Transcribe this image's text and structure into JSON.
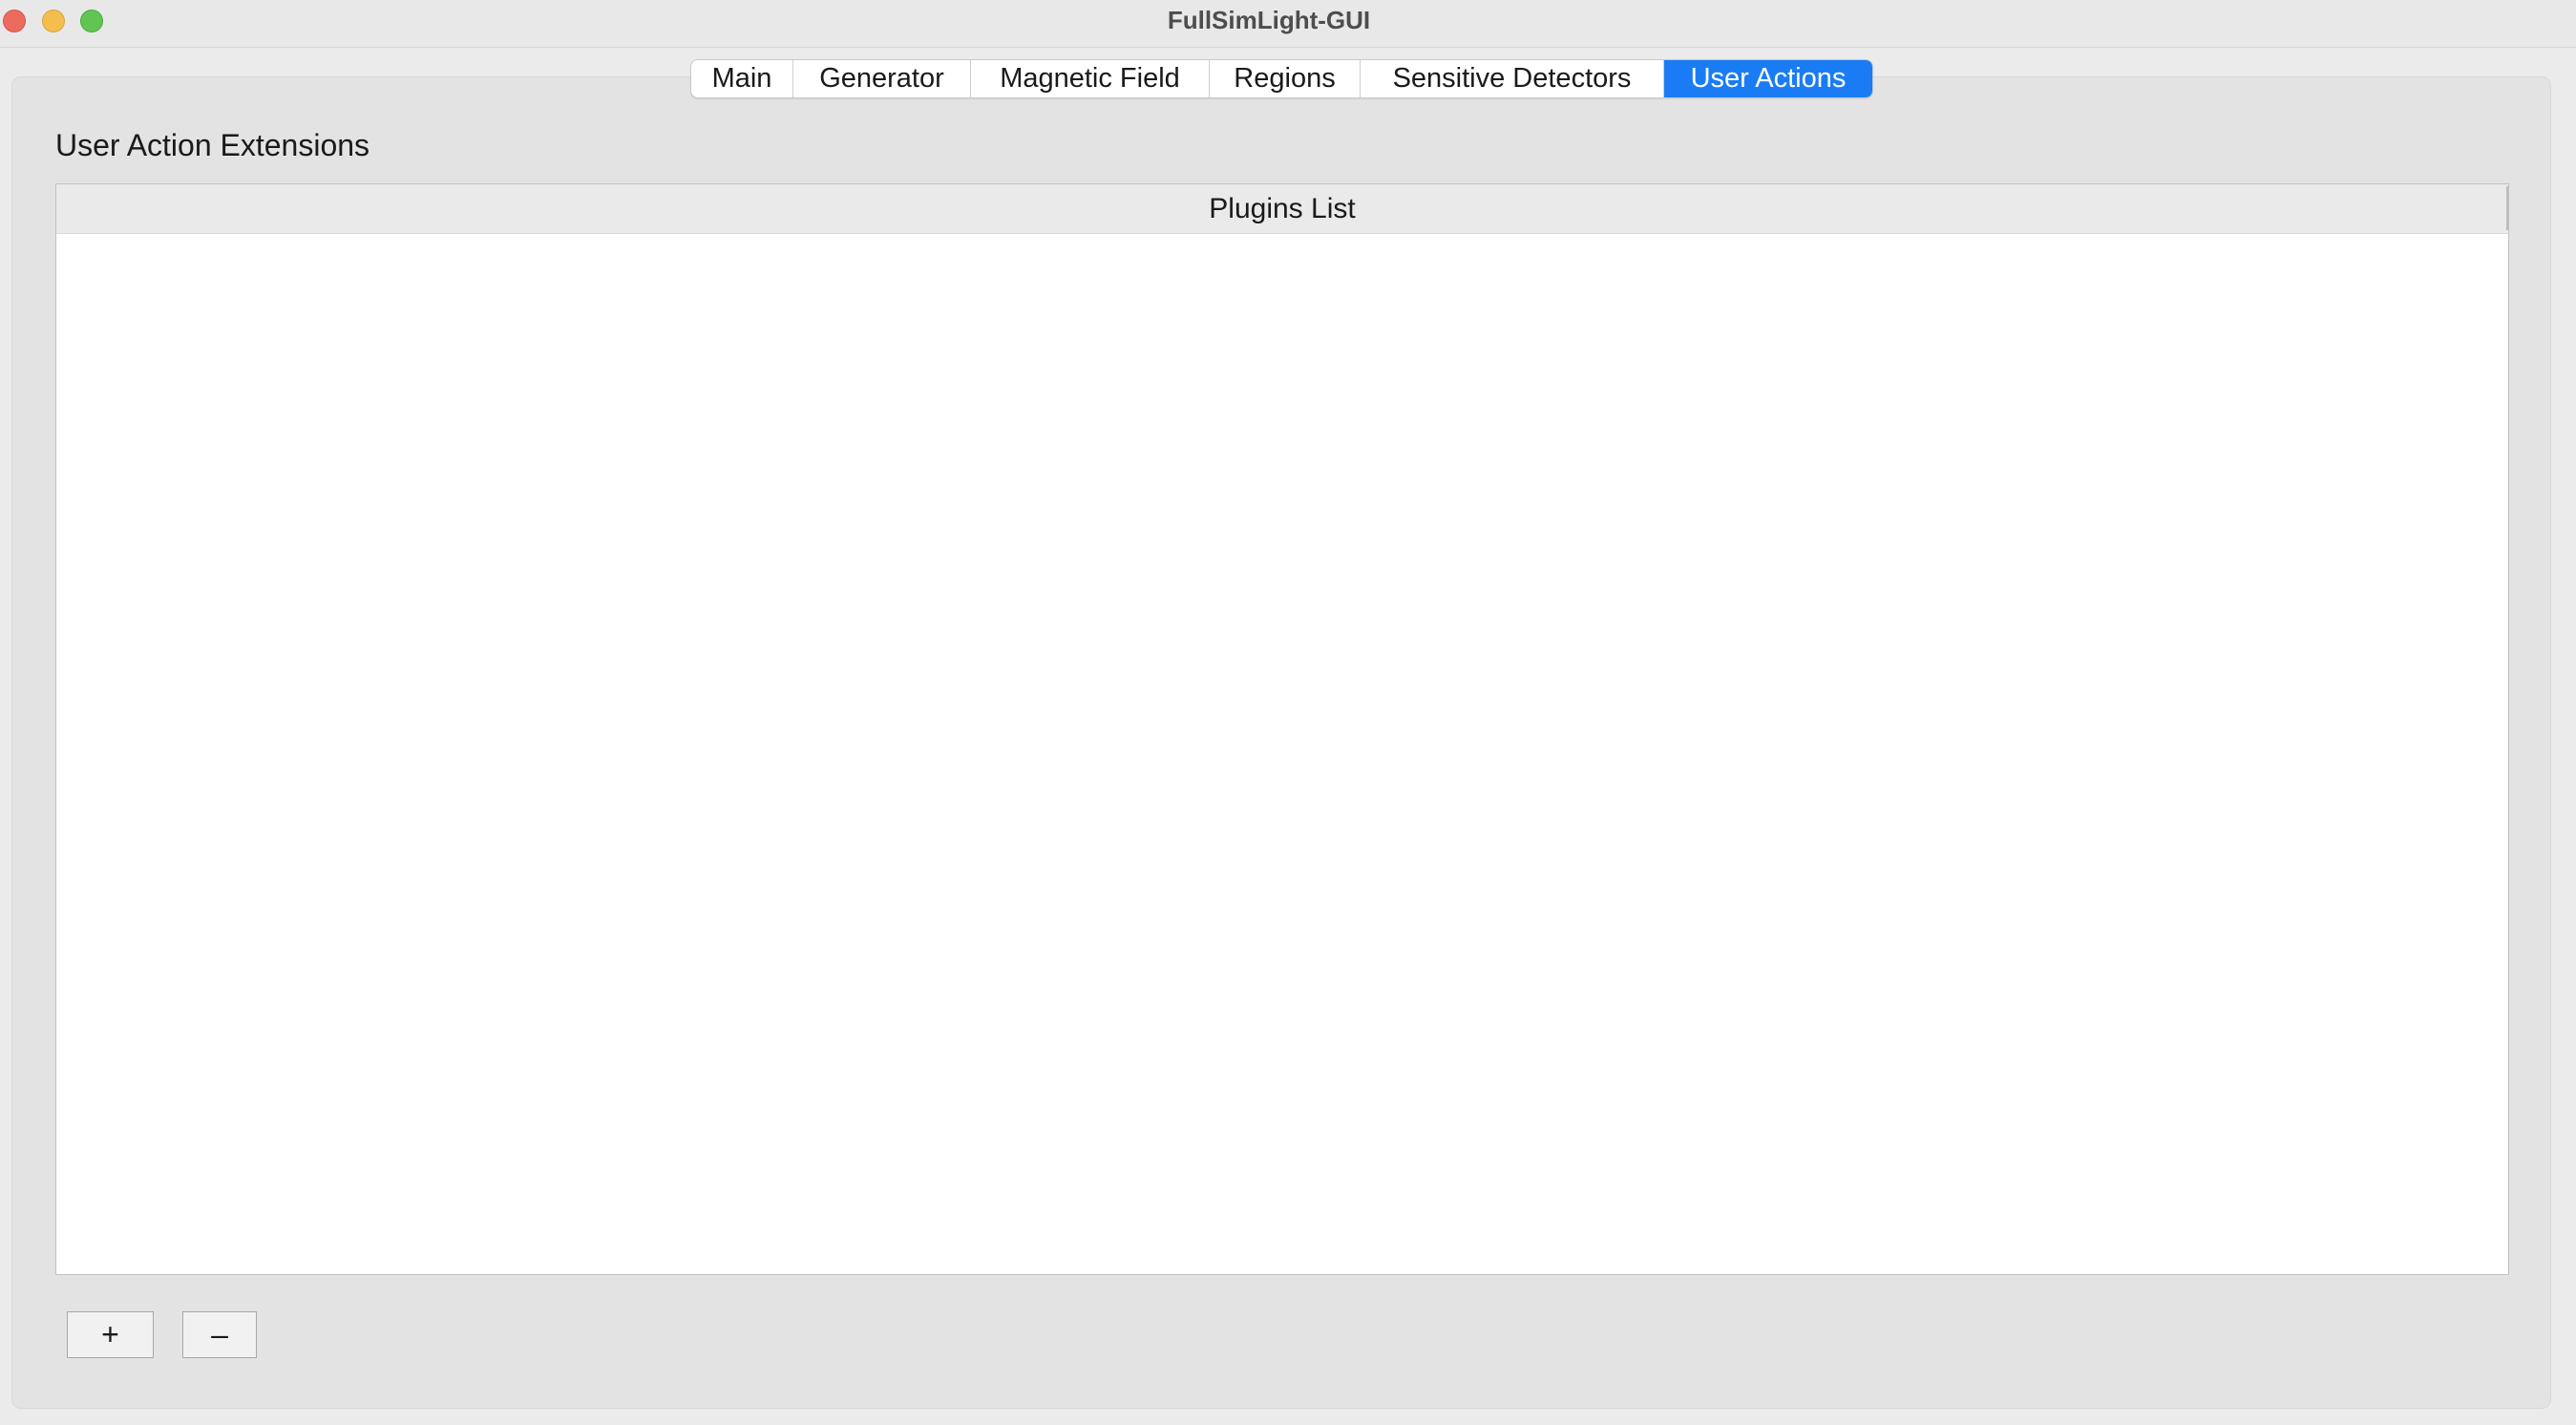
{
  "window": {
    "title": "FullSimLight-GUI"
  },
  "tabs": [
    {
      "label": "Main",
      "active": false
    },
    {
      "label": "Generator",
      "active": false
    },
    {
      "label": "Magnetic Field",
      "active": false
    },
    {
      "label": "Regions",
      "active": false
    },
    {
      "label": "Sensitive Detectors",
      "active": false
    },
    {
      "label": "User Actions",
      "active": true
    }
  ],
  "user_actions": {
    "section_title": "User Action Extensions",
    "list_header": "Plugins List",
    "items": [],
    "add_label": "+",
    "remove_label": "–"
  },
  "colors": {
    "accent": "#1a7cf5",
    "close": "#ec6a5e",
    "minimize": "#f4be4f",
    "maximize": "#61c554"
  }
}
